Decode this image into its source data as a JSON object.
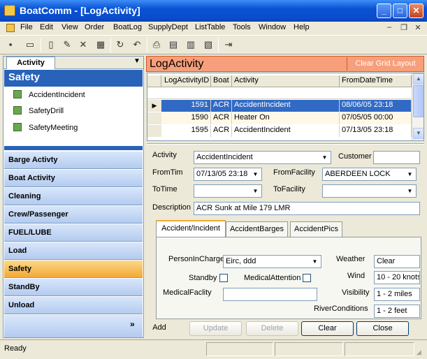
{
  "window": {
    "title": "BoatComm - [LogActivity]"
  },
  "menu": [
    "File",
    "Edit",
    "View",
    "Order",
    "BoatLog",
    "SupplyDept",
    "ListTable",
    "Tools",
    "Window",
    "Help"
  ],
  "left": {
    "tab": "Activity",
    "header": "Safety",
    "items": [
      "AccidentIncident",
      "SafetyDrill",
      "SafetyMeeting"
    ],
    "nav": [
      "Barge Activty",
      "Boat Activity",
      "Cleaning",
      "Crew/Passenger",
      "FUEL/LUBE",
      "Load",
      "Safety",
      "StandBy",
      "Unload"
    ]
  },
  "log": {
    "title": "LogActivity",
    "clear_grid": "Clear Grid Layout",
    "columns": [
      "LogActivityID",
      "Boat",
      "Activity",
      "FromDateTime"
    ],
    "rows": [
      [
        "1591",
        "ACR",
        "AccidentIncident",
        "08/06/05 23:18"
      ],
      [
        "1590",
        "ACR",
        "Heater On",
        "07/05/05 00:00"
      ],
      [
        "1595",
        "ACR",
        "AccidentIncident",
        "07/13/05 23:18"
      ]
    ]
  },
  "form": {
    "activity_label": "Activity",
    "activity_value": "AccidentIncident",
    "customer_label": "Customer",
    "fromtim_label": "FromTim",
    "fromtim_value": "07/13/05 23:18",
    "fromfacility_label": "FromFacility",
    "fromfacility_value": "ABERDEEN LOCK",
    "totime_label": "ToTime",
    "tofacility_label": "ToFacility",
    "description_label": "Description",
    "description_value": "ACR  Sunk at Mile 179 LMR"
  },
  "tabs": [
    "Accident/Incident",
    "AccidentBarges",
    "AccidentPics"
  ],
  "incident": {
    "person_label": "PersonInCharge",
    "person_value": "Eirc, ddd",
    "weather_label": "Weather",
    "weather_value": "Clear",
    "standby_label": "Standby",
    "medattn_label": "MedicalAttention",
    "wind_label": "Wind",
    "wind_value": "10 - 20 knots",
    "medfac_label": "MedicalFaclity",
    "visibility_label": "Visibility",
    "visibility_value": "1 - 2 miles",
    "river_label": "RiverConditions",
    "river_value": "1 - 2 feet"
  },
  "buttons": {
    "add": "Add",
    "update": "Update",
    "delete": "Delete",
    "clear": "Clear",
    "close": "Close"
  },
  "status": {
    "text": "Ready"
  },
  "colors": {
    "title_bar": "#0a4ccb",
    "safety_header": "#2862b9",
    "log_header": "#f79f7b",
    "active_nav": "#f4a836",
    "selected_row": "#316ac5"
  }
}
